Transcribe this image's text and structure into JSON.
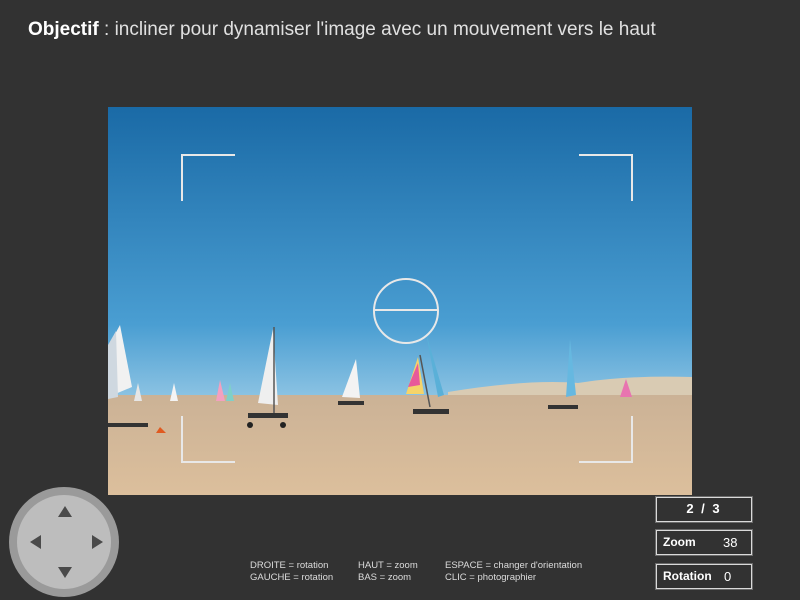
{
  "objective": {
    "label": "Objectif",
    "text": " : incliner pour dynamiser l'image avec un mouvement vers le haut"
  },
  "controls": {
    "right": "DROITE = rotation",
    "left": "GAUCHE  = rotation",
    "up": "HAUT = zoom",
    "down": "BAS = zoom",
    "space": "ESPACE = changer d'orientation",
    "click": "CLIC = photographier"
  },
  "counter": "2 / 3",
  "zoom": {
    "label": "Zoom",
    "value": "38"
  },
  "rotation": {
    "label": "Rotation",
    "value": "0"
  },
  "photo": {
    "subject": "land yachts on a beach",
    "colors": {
      "sky_top": "#1f6ea8",
      "sky_bottom": "#4da0d2",
      "sand": "#d8bc98"
    }
  },
  "icons": [
    "arrow-up-icon",
    "arrow-down-icon",
    "arrow-left-icon",
    "arrow-right-icon",
    "viewfinder-circle-icon"
  ]
}
